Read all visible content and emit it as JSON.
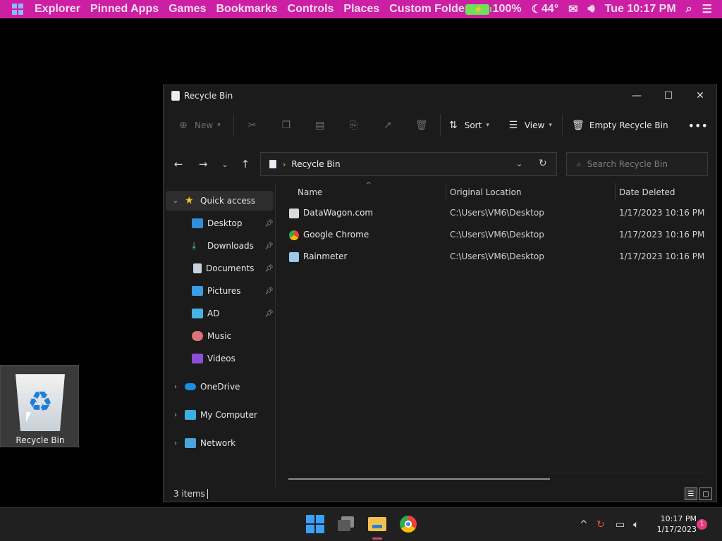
{
  "menubar": {
    "items": [
      "Explorer",
      "Pinned Apps",
      "Games",
      "Bookmarks",
      "Controls",
      "Places",
      "Custom Folder"
    ],
    "battery": "100%",
    "weather": "44°",
    "datetime": "Tue 10:17 PM",
    "icons": [
      "battery-charging-icon",
      "moon-icon",
      "mail-icon",
      "volume-icon",
      "search-icon",
      "list-icon"
    ]
  },
  "window": {
    "title": "Recycle Bin",
    "toolbar": {
      "new_label": "New",
      "sort_label": "Sort",
      "view_label": "View",
      "empty_label": "Empty Recycle Bin"
    },
    "address": {
      "crumb": "Recycle Bin",
      "search_placeholder": "Search Recycle Bin"
    },
    "sidebar": {
      "items": [
        {
          "label": "Quick access",
          "icon": "star-icon"
        },
        {
          "label": "Desktop",
          "icon": "desktop-icon"
        },
        {
          "label": "Downloads",
          "icon": "download-icon"
        },
        {
          "label": "Documents",
          "icon": "document-icon"
        },
        {
          "label": "Pictures",
          "icon": "pictures-icon"
        },
        {
          "label": "AD",
          "icon": "monitor-icon"
        },
        {
          "label": "Music",
          "icon": "music-icon"
        },
        {
          "label": "Videos",
          "icon": "video-icon"
        },
        {
          "label": "OneDrive",
          "icon": "cloud-icon"
        },
        {
          "label": "My Computer",
          "icon": "computer-icon"
        },
        {
          "label": "Network",
          "icon": "network-icon"
        }
      ]
    },
    "columns": {
      "name": "Name",
      "location": "Original Location",
      "date": "Date Deleted"
    },
    "files": [
      {
        "name": "DataWagon.com",
        "location": "C:\\Users\\VM6\\Desktop",
        "date": "1/17/2023 10:16 PM"
      },
      {
        "name": "Google Chrome",
        "location": "C:\\Users\\VM6\\Desktop",
        "date": "1/17/2023 10:16 PM"
      },
      {
        "name": "Rainmeter",
        "location": "C:\\Users\\VM6\\Desktop",
        "date": "1/17/2023 10:16 PM"
      }
    ],
    "status": {
      "count": "3 items"
    }
  },
  "desktop": {
    "recycle_label": "Recycle Bin"
  },
  "taskbar": {
    "time": "10:17 PM",
    "date": "1/17/2023",
    "notifications": "1"
  }
}
